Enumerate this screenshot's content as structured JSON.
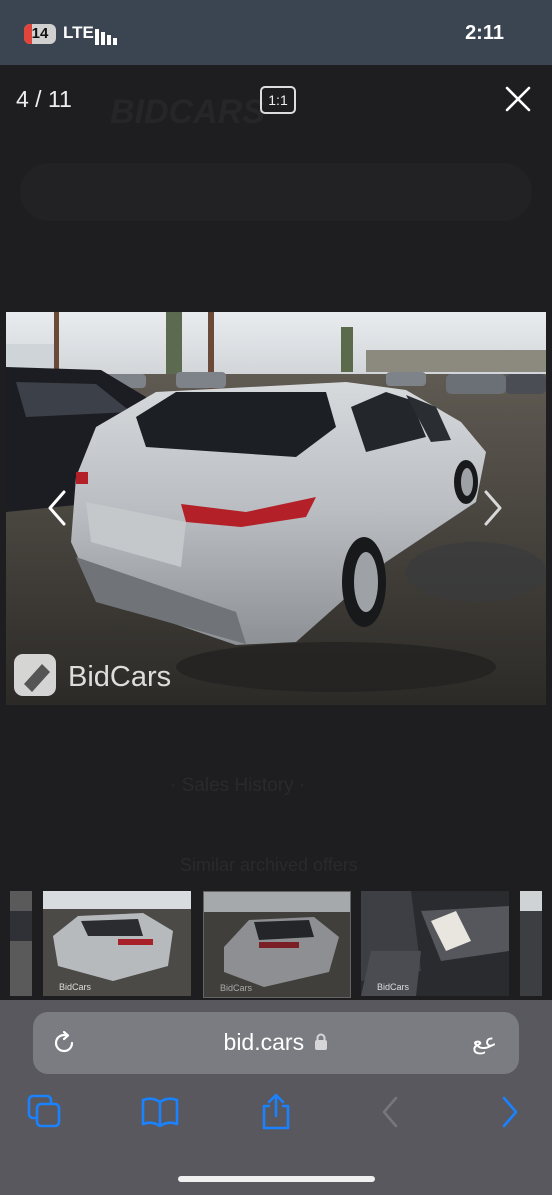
{
  "status": {
    "battery": "14",
    "network": "LTE",
    "time": "2:11"
  },
  "viewer": {
    "counter": "4 / 11",
    "ratio_button": "1:1",
    "watermark": "BidCars",
    "thumb_watermark": "BidCars"
  },
  "browser": {
    "url": "bid.cars",
    "text_size_button": "ع​ع"
  },
  "colors": {
    "status_bg": "#3b4552",
    "viewer_bg": "#1e1e20",
    "toolbar_bg": "#58585e",
    "accent": "#1a82ff"
  },
  "icons": [
    "close-icon",
    "chevron-left-icon",
    "chevron-right-icon",
    "reload-icon",
    "lock-icon",
    "tabs-icon",
    "bookmarks-icon",
    "share-icon",
    "back-icon",
    "forward-icon"
  ]
}
